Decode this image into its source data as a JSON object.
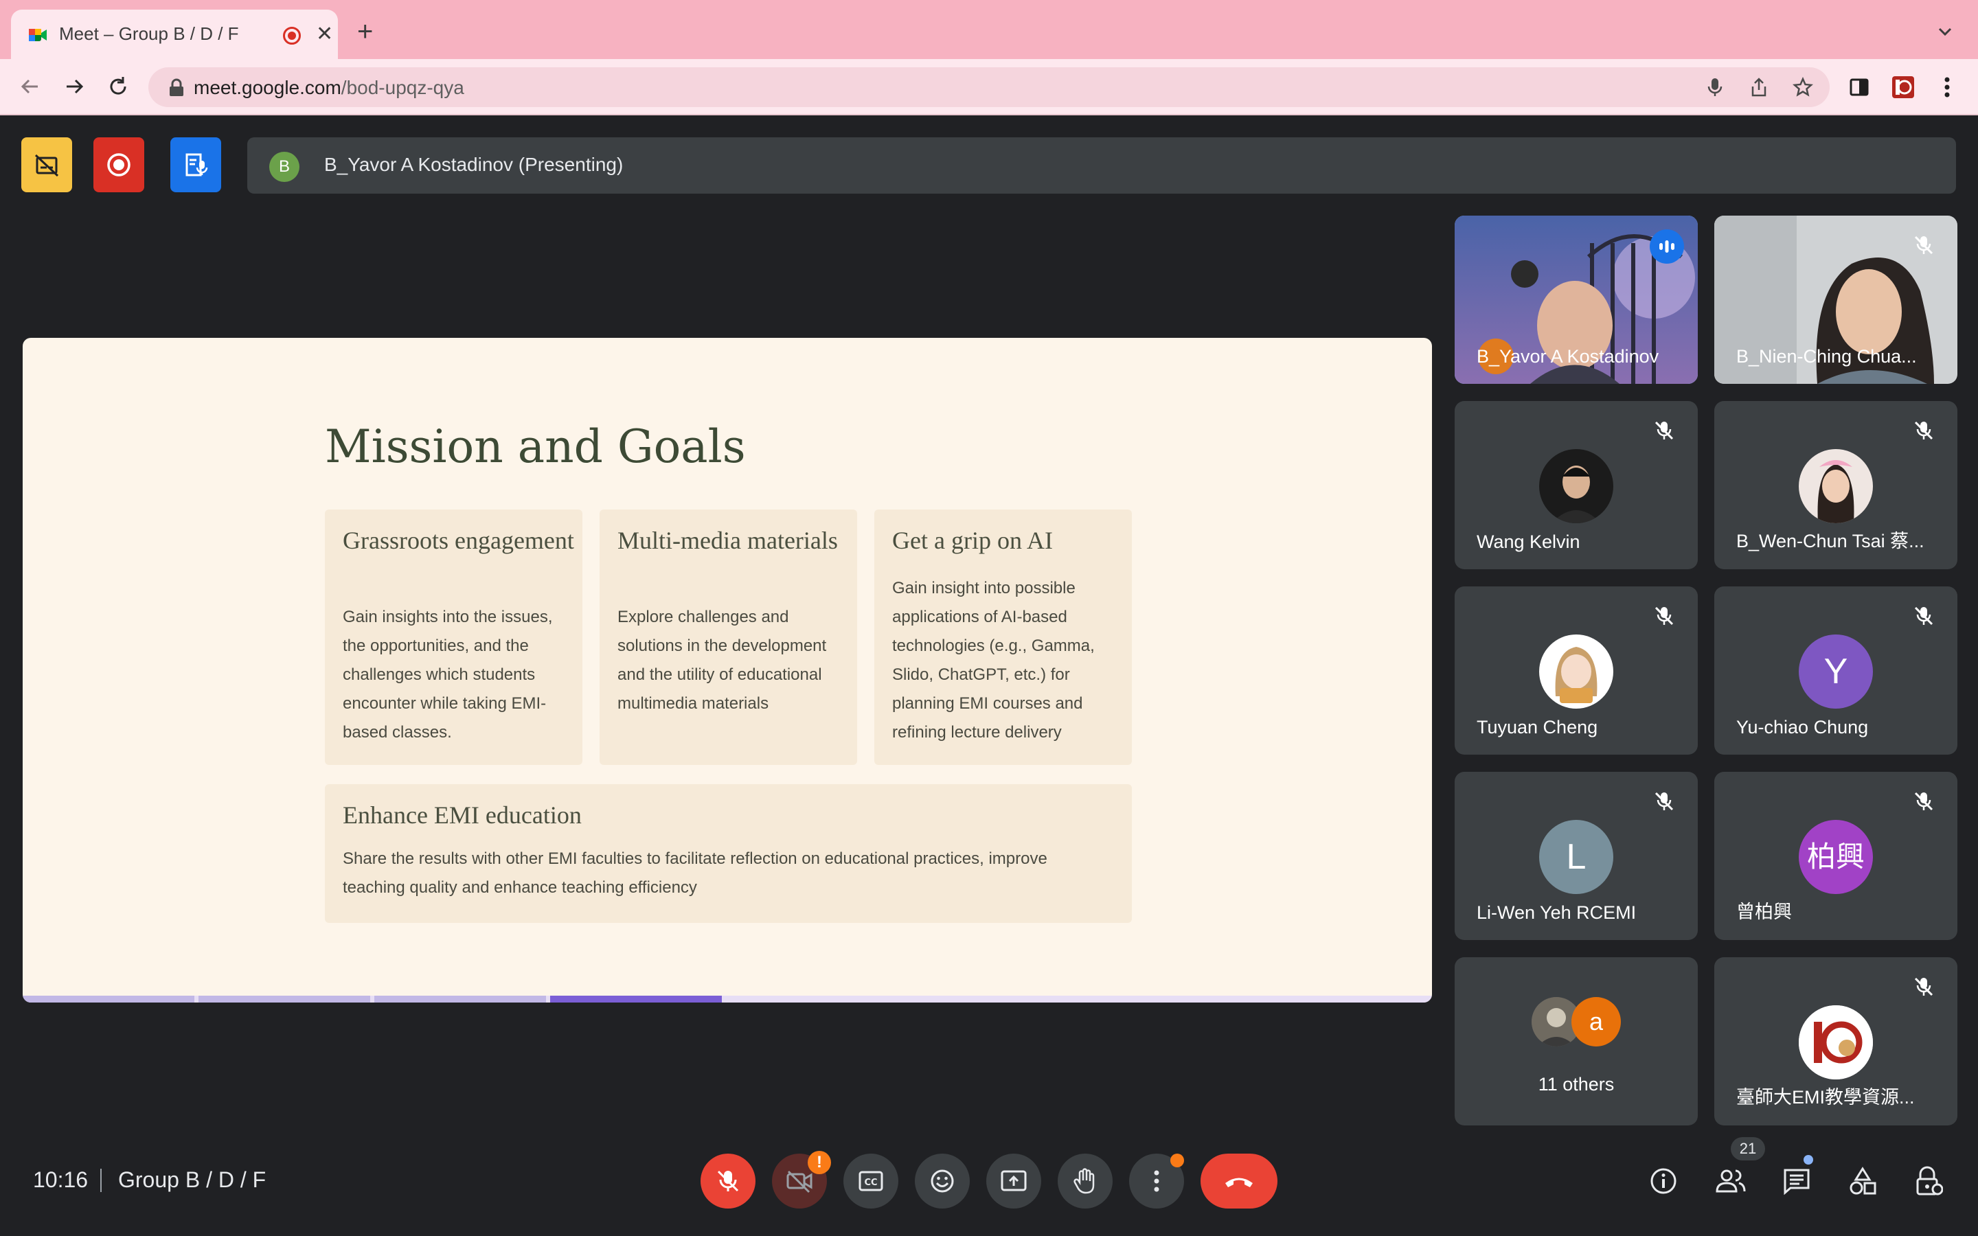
{
  "browser": {
    "tab_title": "Meet – Group B / D / F",
    "new_tab_label": "+",
    "close_label": "✕",
    "url_host": "meet.google.com",
    "url_path": "/bod-upqz-qya"
  },
  "meet": {
    "presenter_initial": "B",
    "presenter_label": "B_Yavor A Kostadinov (Presenting)",
    "clock": "10:16",
    "meeting_name": "Group B / D / F",
    "people_count": "21",
    "warning_mark": "!"
  },
  "slide": {
    "title": "Mission and Goals",
    "cards": [
      {
        "heading": "Grassroots engagement",
        "body": "Gain insights into the issues, the opportunities, and the challenges which students encounter while taking EMI-based classes."
      },
      {
        "heading": "Multi-media materials",
        "body": "Explore challenges and solutions in the development and the utility of educational multimedia materials"
      },
      {
        "heading": "Get a grip on AI",
        "body": "Gain insight into possible applications of AI-based technologies (e.g., Gamma, Slido, ChatGPT, etc.) for planning EMI courses and refining lecture delivery"
      }
    ],
    "wide_card": {
      "heading": "Enhance EMI education",
      "body": "Share the results with other EMI faculties to facilitate reflection on educational practices, improve teaching quality and enhance teaching efficiency"
    }
  },
  "participants": [
    {
      "name": "B_Yavor A Kostadinov",
      "avatar": "",
      "speaking": true
    },
    {
      "name": "B_Nien-Ching Chua...",
      "avatar": ""
    },
    {
      "name": "Wang Kelvin",
      "avatar": ""
    },
    {
      "name": "B_Wen-Chun Tsai 蔡...",
      "avatar": ""
    },
    {
      "name": "Tuyuan Cheng",
      "avatar": ""
    },
    {
      "name": "Yu-chiao Chung",
      "avatar": "Y"
    },
    {
      "name": "Li-Wen Yeh RCEMI",
      "avatar": "L"
    },
    {
      "name": "曾柏興",
      "avatar": "柏興"
    },
    {
      "name": "11 others",
      "avatar": "a"
    },
    {
      "name": "臺師大EMI教學資源...",
      "avatar": ""
    }
  ],
  "colors": {
    "accent_blue": "#1a73e8",
    "end_call_red": "#ea4335",
    "avatar_purple_y": "#7e57c2",
    "avatar_grey_l": "#78909c",
    "avatar_magenta": "#a142c6",
    "avatar_orange": "#e8710a",
    "browser_theme_pink": "#f7b2c1"
  }
}
